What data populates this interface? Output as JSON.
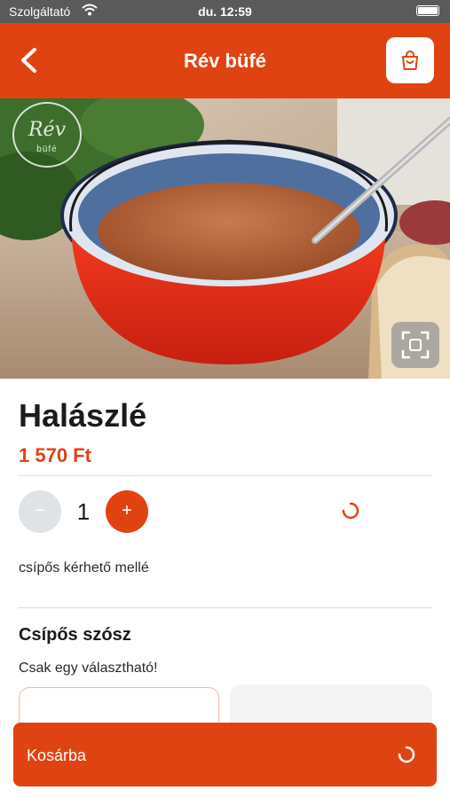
{
  "status": {
    "carrier": "Szolgáltató",
    "time": "du. 12:59"
  },
  "header": {
    "title": "Rév büfé"
  },
  "logo": {
    "text": "Rév",
    "sub": "büfé"
  },
  "product": {
    "name": "Halászlé",
    "price": "1 570 Ft",
    "description": "csípős kérhető mellé"
  },
  "quantity": {
    "minus": "−",
    "value": "1",
    "plus": "+"
  },
  "options": {
    "title": "Csípős szósz",
    "hint": "Csak egy választható!"
  },
  "cart": {
    "button_label": "Kosárba"
  },
  "colors": {
    "brand": "#e04312",
    "minus_bg": "#dfe3e6"
  },
  "icons": [
    "chevron-left-icon",
    "shopping-bag-icon",
    "expand-icon",
    "loading-spinner-icon"
  ]
}
